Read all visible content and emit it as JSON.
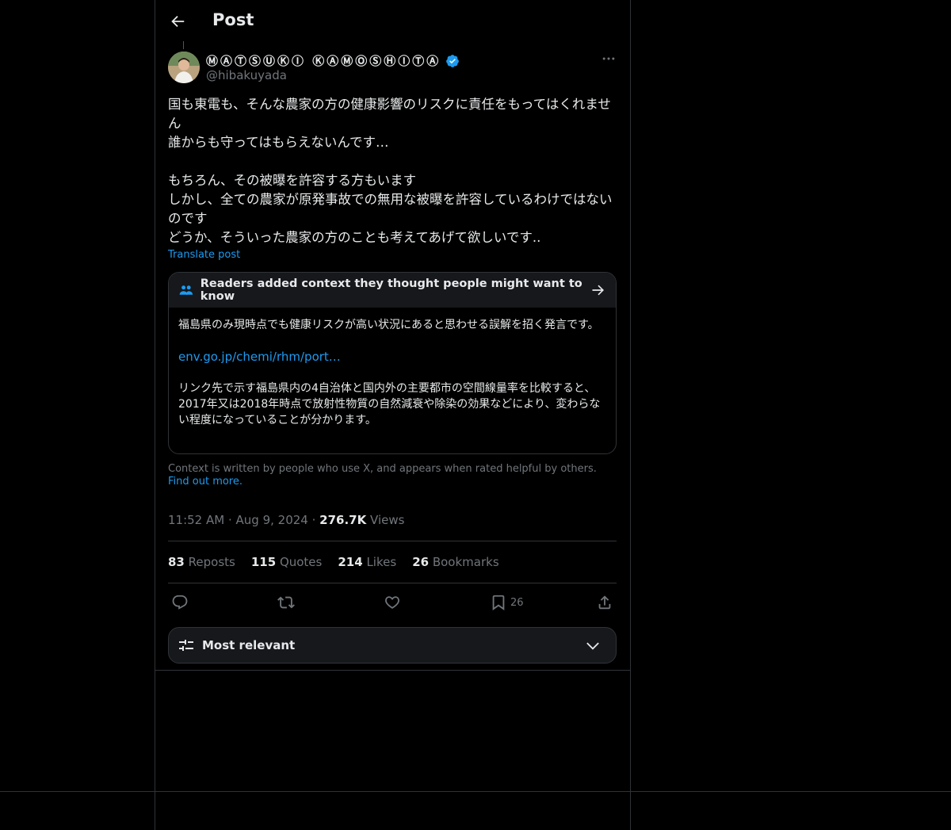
{
  "header": {
    "title": "Post"
  },
  "author": {
    "display_name": "ⓂⒶⓉⓈⓊⓀⒾ ⓀⒶⓂⓄⓈⒽⒾⓉⒶ",
    "handle": "@hibakuyada",
    "verified": true
  },
  "post": {
    "text": "国も東電も、そんな農家の方の健康影響のリスクに責任をもってはくれません\n誰からも守ってはもらえないんです…\n\nもちろん、その被曝を許容する方もいます\nしかし、全ての農家が原発事故での無用な被曝を許容しているわけではないのです\nどうか、そういった農家の方のことも考えてあげて欲しいです..",
    "translate_label": "Translate post",
    "time": "11:52 AM",
    "date": "Aug 9, 2024",
    "views_count": "276.7K",
    "views_label": "Views"
  },
  "community_note": {
    "header": "Readers added context they thought people might want to know",
    "body1": "福島県のみ現時点でも健康リスクが高い状況にあると思わせる誤解を招く発言です。",
    "link": "env.go.jp/chemi/rhm/port…",
    "body2": "リンク先で示す福島県内の4自治体と国内外の主要都市の空間線量率を比較すると、2017年又は2018年時点で放射性物質の自然減衰や除染の効果などにより、変わらない程度になっていることが分かります。",
    "footer_text": "Context is written by people who use X, and appears when rated helpful by others.",
    "footer_link": "Find out more."
  },
  "stats": {
    "reposts_count": "83",
    "reposts_label": "Reposts",
    "quotes_count": "115",
    "quotes_label": "Quotes",
    "likes_count": "214",
    "likes_label": "Likes",
    "bookmarks_count": "26",
    "bookmarks_label": "Bookmarks"
  },
  "actions": {
    "bookmark_count": "26"
  },
  "sort": {
    "label": "Most relevant"
  },
  "colors": {
    "accent": "#1d9bf0",
    "background": "#000000",
    "border": "#2f3336",
    "muted": "#71767b"
  }
}
